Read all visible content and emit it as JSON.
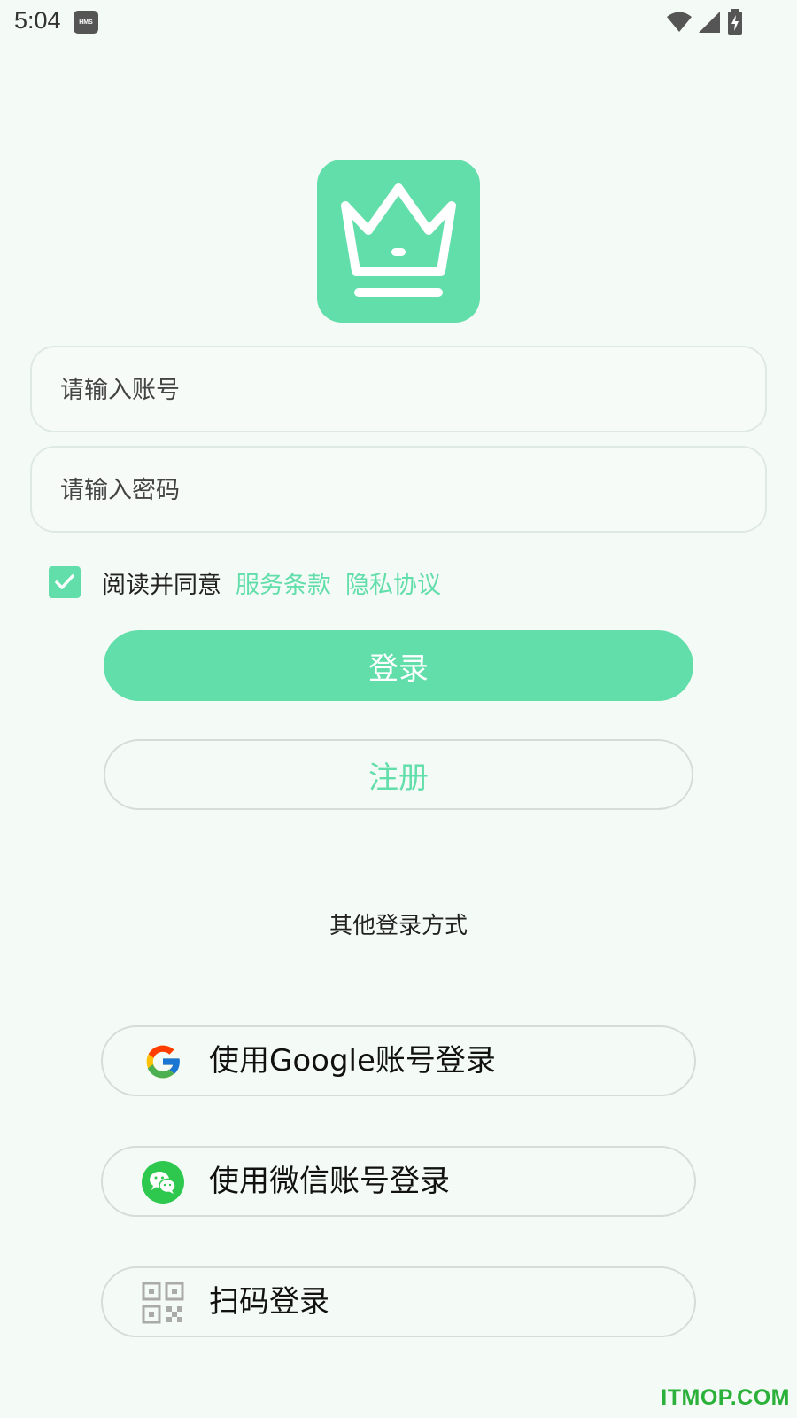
{
  "status_bar": {
    "time": "5:04",
    "badge": "HMS",
    "icons": [
      "wifi-icon",
      "signal-icon",
      "battery-charging-icon"
    ]
  },
  "logo": {
    "icon": "crown-icon",
    "color": "#62deaa"
  },
  "form": {
    "account_placeholder": "请输入账号",
    "account_value": "",
    "password_placeholder": "请输入密码",
    "password_value": ""
  },
  "agreement": {
    "checked": true,
    "text": "阅读并同意",
    "terms_link": "服务条款",
    "privacy_link": "隐私协议"
  },
  "buttons": {
    "login": "登录",
    "register": "注册"
  },
  "other_login": {
    "title": "其他登录方式",
    "google": "使用Google账号登录",
    "wechat": "使用微信账号登录",
    "qr": "扫码登录"
  },
  "watermark": "ITMOP.COM",
  "colors": {
    "accent": "#62deaa",
    "background": "#f4faf6",
    "border": "#d6dcd9",
    "wechat": "#2dc84d"
  }
}
